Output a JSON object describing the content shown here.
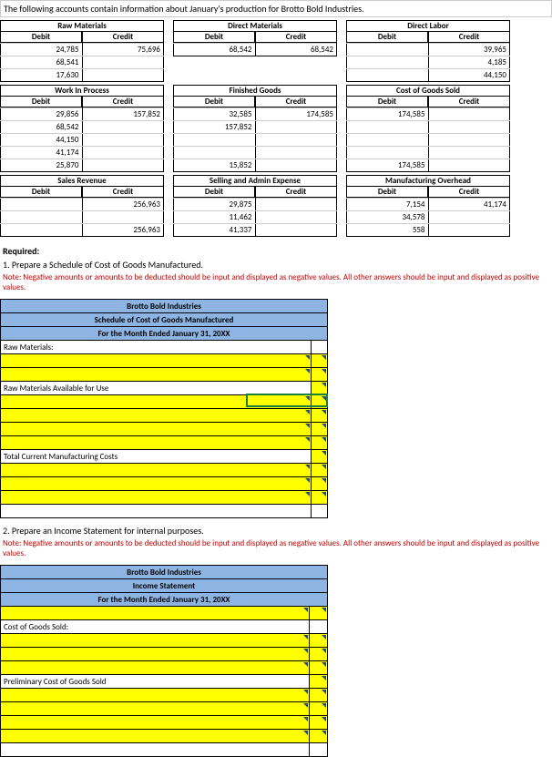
{
  "intro": "The following accounts contain information about January's production for Brotto Bold Industries.",
  "accounts": {
    "rawMaterials": {
      "title": "Raw Materials",
      "debit": [
        "24,785",
        "68,541",
        "17,630"
      ],
      "credit": [
        "75,696",
        "",
        ""
      ]
    },
    "directMaterials": {
      "title": "Direct Materials",
      "debit": [
        "68,542"
      ],
      "credit": [
        "68,542"
      ]
    },
    "directLabor": {
      "title": "Direct Labor",
      "debit": [
        "",
        "",
        ""
      ],
      "credit": [
        "39,965",
        "4,185",
        "44,150"
      ]
    },
    "wip": {
      "title": "Work In Process",
      "debit": [
        "29,856",
        "68,542",
        "44,150",
        "41,174",
        "25,870"
      ],
      "credit": [
        "157,852",
        "",
        "",
        "",
        ""
      ]
    },
    "finishedGoods": {
      "title": "Finished Goods",
      "debit": [
        "32,585",
        "157,852",
        "",
        "",
        "15,852"
      ],
      "credit": [
        "174,585",
        "",
        "",
        "",
        ""
      ]
    },
    "cogs": {
      "title": "Cost of Goods Sold",
      "debit": [
        "174,585",
        "",
        "",
        "",
        "174,585"
      ],
      "credit": [
        "",
        "",
        "",
        "",
        ""
      ]
    },
    "salesRevenue": {
      "title": "Sales Revenue",
      "debit": [
        "",
        "",
        ""
      ],
      "credit": [
        "256,963",
        "",
        "256,963"
      ]
    },
    "sellingAdmin": {
      "title": "Selling and Admin Expense",
      "debit": [
        "29,875",
        "11,462",
        "41,337"
      ],
      "credit": [
        "",
        "",
        ""
      ]
    },
    "mfgOverhead": {
      "title": "Manufacturing Overhead",
      "debit": [
        "7,154",
        "34,578",
        "558"
      ],
      "credit": [
        "41,174",
        "",
        ""
      ]
    }
  },
  "required": "Required:",
  "req1": "1. Prepare a Schedule of Cost of Goods Manufactured.",
  "req2": "2. Prepare an Income Statement for internal purposes.",
  "note": "Note: Negative amounts or amounts to be deducted should be input and displayed as negative values. All other answers should be input and displayed as positive values.",
  "schedule": {
    "company": "Brotto Bold Industries",
    "title": "Schedule of Cost of Goods Manufactured",
    "period": "For the Month Ended January 31, 20XX",
    "rows": {
      "rawMat": "Raw Materials:",
      "rawMatAvail": "Raw Materials Available for Use",
      "totalCurrent": "Total Current Manufacturing Costs"
    }
  },
  "income": {
    "company": "Brotto Bold Industries",
    "title": "Income Statement",
    "period": "For the Month Ended January 31, 20XX",
    "rows": {
      "cogs": "Cost of Goods Sold:",
      "prelim": "Preliminary Cost of Goods Sold"
    }
  },
  "chart_data": [
    {
      "type": "table",
      "title": "Raw Materials",
      "columns": [
        "Debit",
        "Credit"
      ],
      "rows": [
        [
          24785,
          75696
        ],
        [
          68541,
          null
        ],
        [
          17630,
          null
        ]
      ]
    },
    {
      "type": "table",
      "title": "Direct Materials",
      "columns": [
        "Debit",
        "Credit"
      ],
      "rows": [
        [
          68542,
          68542
        ]
      ]
    },
    {
      "type": "table",
      "title": "Direct Labor",
      "columns": [
        "Debit",
        "Credit"
      ],
      "rows": [
        [
          null,
          39965
        ],
        [
          null,
          4185
        ],
        [
          null,
          44150
        ]
      ]
    },
    {
      "type": "table",
      "title": "Work In Process",
      "columns": [
        "Debit",
        "Credit"
      ],
      "rows": [
        [
          29856,
          157852
        ],
        [
          68542,
          null
        ],
        [
          44150,
          null
        ],
        [
          41174,
          null
        ],
        [
          25870,
          null
        ]
      ]
    },
    {
      "type": "table",
      "title": "Finished Goods",
      "columns": [
        "Debit",
        "Credit"
      ],
      "rows": [
        [
          32585,
          174585
        ],
        [
          157852,
          null
        ],
        [
          null,
          null
        ],
        [
          null,
          null
        ],
        [
          15852,
          null
        ]
      ]
    },
    {
      "type": "table",
      "title": "Cost of Goods Sold",
      "columns": [
        "Debit",
        "Credit"
      ],
      "rows": [
        [
          174585,
          null
        ],
        [
          null,
          null
        ],
        [
          null,
          null
        ],
        [
          null,
          null
        ],
        [
          174585,
          null
        ]
      ]
    },
    {
      "type": "table",
      "title": "Sales Revenue",
      "columns": [
        "Debit",
        "Credit"
      ],
      "rows": [
        [
          null,
          256963
        ],
        [
          null,
          null
        ],
        [
          null,
          256963
        ]
      ]
    },
    {
      "type": "table",
      "title": "Selling and Admin Expense",
      "columns": [
        "Debit",
        "Credit"
      ],
      "rows": [
        [
          29875,
          null
        ],
        [
          11462,
          null
        ],
        [
          41337,
          null
        ]
      ]
    },
    {
      "type": "table",
      "title": "Manufacturing Overhead",
      "columns": [
        "Debit",
        "Credit"
      ],
      "rows": [
        [
          7154,
          41174
        ],
        [
          34578,
          null
        ],
        [
          558,
          null
        ]
      ]
    }
  ]
}
